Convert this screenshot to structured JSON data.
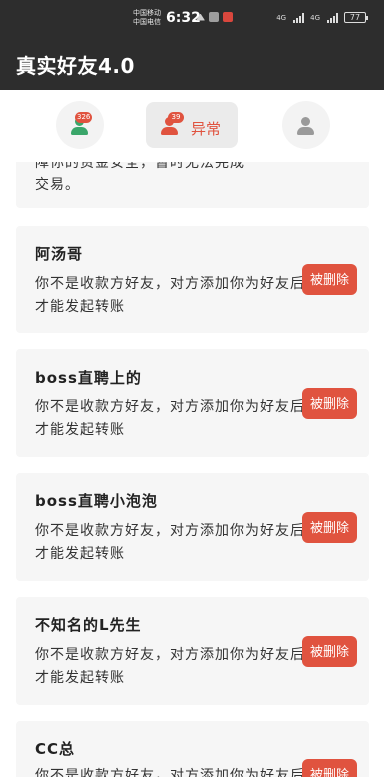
{
  "status_bar": {
    "carrier_1": "中国移动",
    "carrier_2": "中国电信",
    "time": "6:32",
    "signal_label_1": "4G",
    "signal_label_2": "4G",
    "battery": "77"
  },
  "app_bar": {
    "title": "真实好友4.0"
  },
  "tabs": [
    {
      "name": "normal-friends",
      "badge": "326",
      "icon": "person-icon",
      "color": "#3aa66a",
      "label": "",
      "active": false
    },
    {
      "name": "abnormal",
      "badge": "39",
      "icon": "person-icon",
      "color": "#e0533f",
      "label": "异常",
      "active": true
    },
    {
      "name": "other",
      "badge": "",
      "icon": "person-icon",
      "color": "#9a9a9a",
      "label": "",
      "active": false
    }
  ],
  "partial_card": {
    "line1": "障你的资金安全，暂时无法完成",
    "line2": "交易。"
  },
  "cards": [
    {
      "name": "阿汤哥",
      "message": "你不是收款方好友，对方添加你为好友后才能发起转账",
      "action": "被删除"
    },
    {
      "name": "boss直聘上的",
      "message": "你不是收款方好友，对方添加你为好友后才能发起转账",
      "action": "被删除"
    },
    {
      "name": "boss直聘小泡泡",
      "message": "你不是收款方好友，对方添加你为好友后才能发起转账",
      "action": "被删除"
    },
    {
      "name": "不知名的L先生",
      "message": "你不是收款方好友，对方添加你为好友后才能发起转账",
      "action": "被删除"
    },
    {
      "name": "CC总",
      "message": "你不是收款方好友，对方添加你为好友后才能发起转账",
      "action": "被删除"
    }
  ]
}
